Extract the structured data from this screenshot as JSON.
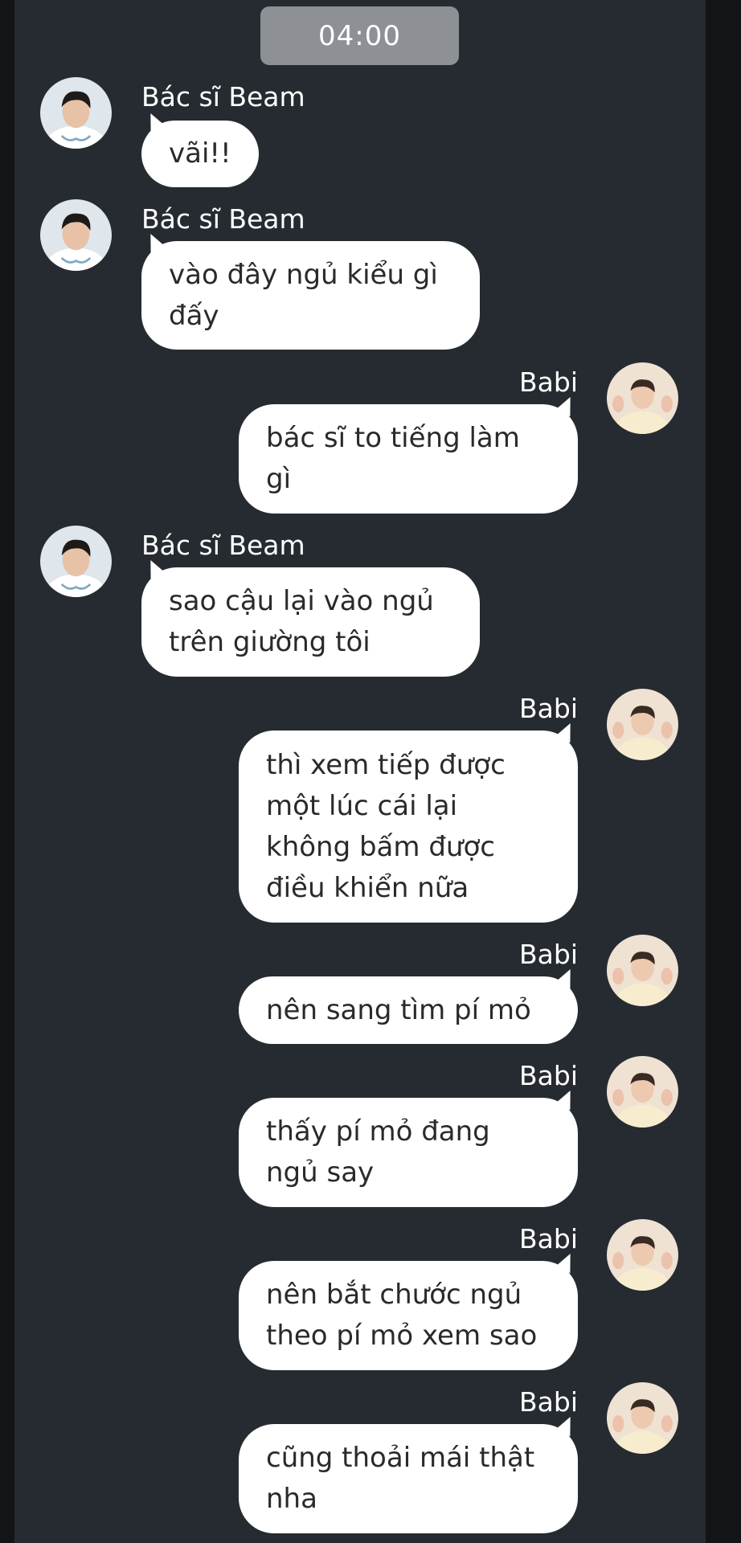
{
  "chat": {
    "time_label": "04:00",
    "colors": {
      "background": "#262b31",
      "bubble": "#ffffff",
      "time_pill": "#8d9095"
    },
    "messages": [
      {
        "sender": "Bác sĩ Beam",
        "side": "left",
        "text": "vãi!!"
      },
      {
        "sender": "Bác sĩ Beam",
        "side": "left",
        "text": "vào đây ngủ kiểu gì\nđấy"
      },
      {
        "sender": "Babi",
        "side": "right",
        "text": "bác sĩ to tiếng làm\ngì"
      },
      {
        "sender": "Bác sĩ Beam",
        "side": "left",
        "text": "sao cậu lại vào ngủ\ntrên giường tôi"
      },
      {
        "sender": "Babi",
        "side": "right",
        "text": "thì xem tiếp được\nmột lúc cái lại\nkhông bấm được\nđiều khiển nữa"
      },
      {
        "sender": "Babi",
        "side": "right",
        "text": "nên sang tìm pí mỏ"
      },
      {
        "sender": "Babi",
        "side": "right",
        "text": "thấy pí mỏ đang\nngủ say"
      },
      {
        "sender": "Babi",
        "side": "right",
        "text": "nên bắt chước ngủ\ntheo pí mỏ xem sao"
      },
      {
        "sender": "Babi",
        "side": "right",
        "text": "cũng thoải mái thật\nnha"
      }
    ]
  }
}
